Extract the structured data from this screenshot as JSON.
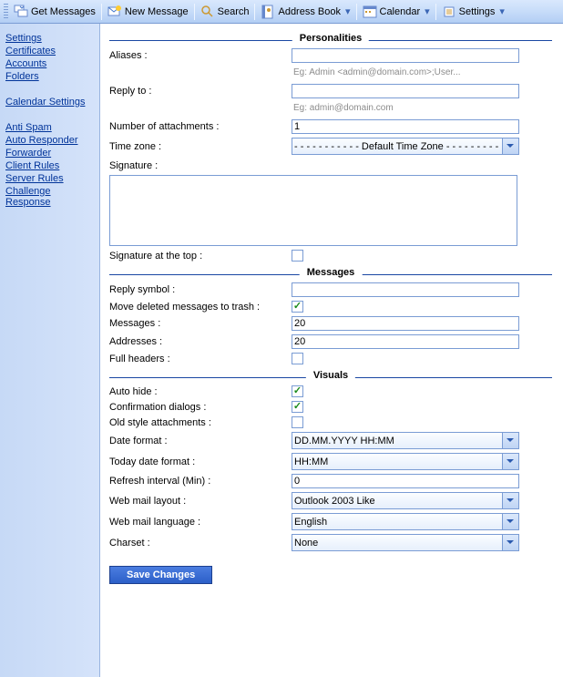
{
  "toolbar": {
    "get_messages": "Get Messages",
    "new_message": "New Message",
    "search": "Search",
    "address_book": "Address Book",
    "calendar": "Calendar",
    "settings": "Settings"
  },
  "sidebar": {
    "group1": [
      {
        "label": "Settings"
      },
      {
        "label": "Certificates"
      },
      {
        "label": "Accounts"
      },
      {
        "label": "Folders"
      }
    ],
    "calendar": "Calendar Settings",
    "group2": [
      {
        "label": "Anti Spam"
      },
      {
        "label": "Auto Responder"
      },
      {
        "label": "Forwarder"
      },
      {
        "label": "Client Rules"
      },
      {
        "label": "Server Rules"
      },
      {
        "label": "Challenge Response"
      }
    ]
  },
  "sections": {
    "personalities": "Personalities",
    "messages": "Messages",
    "visuals": "Visuals"
  },
  "personalities": {
    "aliases_label": "Aliases :",
    "aliases_value": "",
    "aliases_hint": "Eg: Admin <admin@domain.com>;User...",
    "reply_to_label": "Reply to :",
    "reply_to_value": "",
    "reply_to_hint": "Eg: admin@domain.com",
    "num_attach_label": "Number of attachments :",
    "num_attach_value": "1",
    "timezone_label": "Time zone :",
    "timezone_value": "- - - - - - - - - - - Default Time Zone - - - - - - - - -",
    "signature_label": "Signature :",
    "signature_value": "",
    "sig_top_label": "Signature at the top :",
    "sig_top_checked": false
  },
  "messages": {
    "reply_symbol_label": "Reply symbol :",
    "reply_symbol_value": "",
    "move_trash_label": "Move deleted messages to trash :",
    "move_trash_checked": true,
    "messages_label": "Messages :",
    "messages_value": "20",
    "addresses_label": "Addresses :",
    "addresses_value": "20",
    "full_headers_label": "Full headers :",
    "full_headers_checked": false
  },
  "visuals": {
    "auto_hide_label": "Auto hide :",
    "auto_hide_checked": true,
    "confirm_label": "Confirmation dialogs :",
    "confirm_checked": true,
    "old_attach_label": "Old style attachments :",
    "old_attach_checked": false,
    "date_format_label": "Date format :",
    "date_format_value": "DD.MM.YYYY HH:MM",
    "today_format_label": "Today date format :",
    "today_format_value": "HH:MM",
    "refresh_label": "Refresh interval (Min) :",
    "refresh_value": "0",
    "layout_label": "Web mail layout :",
    "layout_value": "Outlook 2003 Like",
    "language_label": "Web mail language :",
    "language_value": "English",
    "charset_label": "Charset :",
    "charset_value": "None"
  },
  "save_label": "Save Changes"
}
